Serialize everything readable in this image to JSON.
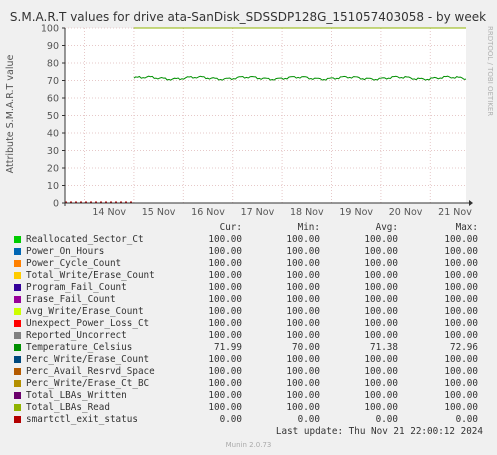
{
  "chart_data": {
    "type": "line",
    "title": "S.M.A.R.T values for drive ata-SanDisk_SDSSDP128G_151057403058 - by week",
    "ylabel": "Attribute S.M.A.R.T value",
    "xlabel": "",
    "ylim": [
      0,
      100
    ],
    "y_ticks": [
      "0",
      "10",
      "20",
      "30",
      "40",
      "50",
      "60",
      "70",
      "80",
      "90",
      "100"
    ],
    "x_ticks": [
      "14 Nov",
      "15 Nov",
      "16 Nov",
      "17 Nov",
      "18 Nov",
      "19 Nov",
      "20 Nov",
      "21 Nov"
    ],
    "grid": true,
    "data_start": "15 Nov",
    "series": [
      {
        "name": "Reallocated_Sector_Ct",
        "color": "#00cc00",
        "cur": "100.00",
        "min": "100.00",
        "avg": "100.00",
        "max": "100.00"
      },
      {
        "name": "Power_On_Hours",
        "color": "#0066b3",
        "cur": "100.00",
        "min": "100.00",
        "avg": "100.00",
        "max": "100.00"
      },
      {
        "name": "Power_Cycle_Count",
        "color": "#ff8000",
        "cur": "100.00",
        "min": "100.00",
        "avg": "100.00",
        "max": "100.00"
      },
      {
        "name": "Total_Write/Erase_Count",
        "color": "#ffcc00",
        "cur": "100.00",
        "min": "100.00",
        "avg": "100.00",
        "max": "100.00"
      },
      {
        "name": "Program_Fail_Count",
        "color": "#330099",
        "cur": "100.00",
        "min": "100.00",
        "avg": "100.00",
        "max": "100.00"
      },
      {
        "name": "Erase_Fail_Count",
        "color": "#990099",
        "cur": "100.00",
        "min": "100.00",
        "avg": "100.00",
        "max": "100.00"
      },
      {
        "name": "Avg_Write/Erase_Count",
        "color": "#ccff00",
        "cur": "100.00",
        "min": "100.00",
        "avg": "100.00",
        "max": "100.00"
      },
      {
        "name": "Unexpect_Power_Loss_Ct",
        "color": "#ff0000",
        "cur": "100.00",
        "min": "100.00",
        "avg": "100.00",
        "max": "100.00"
      },
      {
        "name": "Reported_Uncorrect",
        "color": "#808080",
        "cur": "100.00",
        "min": "100.00",
        "avg": "100.00",
        "max": "100.00"
      },
      {
        "name": "Temperature_Celsius",
        "color": "#008f00",
        "cur": "71.99",
        "min": "70.00",
        "avg": "71.38",
        "max": "72.96"
      },
      {
        "name": "Perc_Write/Erase_Count",
        "color": "#00487d",
        "cur": "100.00",
        "min": "100.00",
        "avg": "100.00",
        "max": "100.00"
      },
      {
        "name": "Perc_Avail_Resrvd_Space",
        "color": "#b35a00",
        "cur": "100.00",
        "min": "100.00",
        "avg": "100.00",
        "max": "100.00"
      },
      {
        "name": "Perc_Write/Erase_Ct_BC",
        "color": "#b38f00",
        "cur": "100.00",
        "min": "100.00",
        "avg": "100.00",
        "max": "100.00"
      },
      {
        "name": "Total_LBAs_Written",
        "color": "#6b006b",
        "cur": "100.00",
        "min": "100.00",
        "avg": "100.00",
        "max": "100.00"
      },
      {
        "name": "Total_LBAs_Read",
        "color": "#8fb300",
        "cur": "100.00",
        "min": "100.00",
        "avg": "100.00",
        "max": "100.00"
      },
      {
        "name": "smartctl_exit_status",
        "color": "#b30000",
        "cur": "0.00",
        "min": "0.00",
        "avg": "0.00",
        "max": "0.00"
      }
    ]
  },
  "legend_header": {
    "cur": "Cur:",
    "min": "Min:",
    "avg": "Avg:",
    "max": "Max:"
  },
  "last_update": "Last update: Thu Nov 21 22:00:12 2024",
  "munin_version": "Munin 2.0.73",
  "rrd_credit": "RRDTOOL / TOBI OETIKER"
}
